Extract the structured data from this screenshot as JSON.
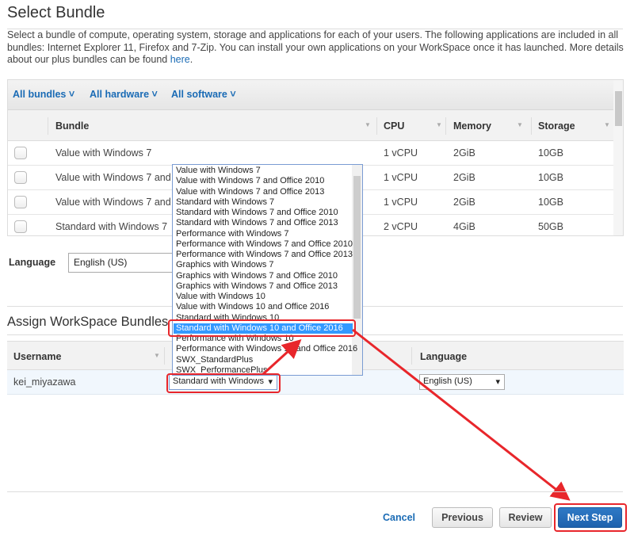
{
  "title": "Select Bundle",
  "description": "Select a bundle of compute, operating system, storage and applications for each of your users. The following applications are included in all bundles: Internet Explorer 11, Firefox and 7-Zip. You can install your own applications on your WorkSpace once it has launched. More details about our plus bundles can be found ",
  "description_link": "here",
  "description_end": ".",
  "filters": [
    "All bundles",
    "All hardware",
    "All software"
  ],
  "columns": [
    "Bundle",
    "CPU",
    "Memory",
    "Storage"
  ],
  "rows": [
    {
      "bundle": "Value with Windows 7",
      "cpu": "1 vCPU",
      "memory": "2GiB",
      "storage": "10GB"
    },
    {
      "bundle": "Value with Windows 7 and Office 2010",
      "cpu": "1 vCPU",
      "memory": "2GiB",
      "storage": "10GB"
    },
    {
      "bundle": "Value with Windows 7 and Office 2013",
      "cpu": "1 vCPU",
      "memory": "2GiB",
      "storage": "10GB"
    },
    {
      "bundle": "Standard with Windows 7",
      "cpu": "2 vCPU",
      "memory": "4GiB",
      "storage": "50GB"
    }
  ],
  "language": {
    "label": "Language",
    "value": "English (US)"
  },
  "assign": {
    "title": "Assign WorkSpace Bundles",
    "columns": {
      "username": "Username",
      "language": "Language"
    },
    "row": {
      "username": "kei_miyazawa",
      "bundle": "Standard with Windows",
      "language": "English (US)"
    }
  },
  "dropdown_options": [
    "Value with Windows 7",
    "Value with Windows 7 and Office 2010",
    "Value with Windows 7 and Office 2013",
    "Standard with Windows 7",
    "Standard with Windows 7 and Office 2010",
    "Standard with Windows 7 and Office 2013",
    "Performance with Windows 7",
    "Performance with Windows 7 and Office 2010",
    "Performance with Windows 7 and Office 2013",
    "Graphics with Windows 7",
    "Graphics with Windows 7 and Office 2010",
    "Graphics with Windows 7 and Office 2013",
    "Value with Windows 10",
    "Value with Windows 10 and Office 2016",
    "Standard with Windows 10",
    "Standard with Windows 10 and Office 2016",
    "Performance with Windows 10",
    "Performance with Windows 10 and Office 2016",
    "SWX_StandardPlus",
    "SWX_PerformancePlus"
  ],
  "dropdown_highlighted": "Standard with Windows 10 and Office 2016",
  "footer": {
    "cancel": "Cancel",
    "previous": "Previous",
    "review": "Review",
    "next": "Next Step"
  },
  "colors": {
    "accent": "#1a6bb5",
    "annotation": "#e8262b",
    "highlight": "#3399ff"
  }
}
